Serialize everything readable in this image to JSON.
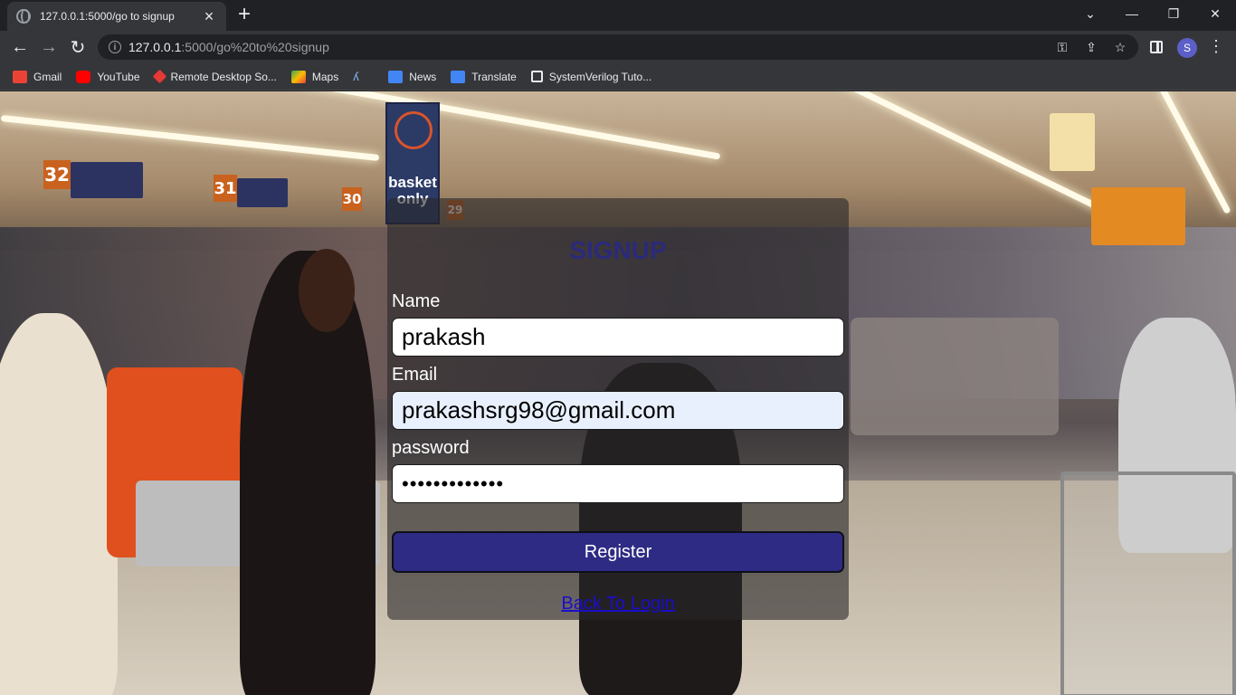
{
  "browser": {
    "tab_title": "127.0.0.1:5000/go to signup",
    "new_tab_symbol": "+",
    "url_host": "127.0.0.1",
    "url_rest": ":5000/go%20to%20signup",
    "profile_initial": "S",
    "window_controls": [
      "⌄",
      "—",
      "❐",
      "✕"
    ]
  },
  "bookmarks": [
    {
      "label": "Gmail",
      "icon": "gmail-icon",
      "color": "#ea4335"
    },
    {
      "label": "YouTube",
      "icon": "youtube-icon",
      "color": "#ff0000"
    },
    {
      "label": "Remote Desktop So...",
      "icon": "remote-desktop-icon",
      "color": "#e53935"
    },
    {
      "label": "Maps",
      "icon": "maps-icon",
      "color": "#34a853"
    },
    {
      "label": "",
      "icon": "bookmark-a-icon",
      "color": "#8ab4f8"
    },
    {
      "label": "News",
      "icon": "news-icon",
      "color": "#4285f4"
    },
    {
      "label": "Translate",
      "icon": "translate-icon",
      "color": "#4285f4"
    },
    {
      "label": "SystemVerilog Tuto...",
      "icon": "chip-icon",
      "color": "#e8eaed"
    }
  ],
  "scene_signs": {
    "aisle_32": "32",
    "aisle_31": "31",
    "aisle_30": "30",
    "aisle_29": "29",
    "basket_line1": "basket",
    "basket_line2": "only"
  },
  "signup": {
    "title": "SIGNUP",
    "name_label": "Name",
    "name_value": "prakash",
    "email_label": "Email",
    "email_value": "prakashsrg98@gmail.com",
    "password_label": "password",
    "password_value": "•••••••••••••",
    "register_label": "Register",
    "back_link_label": "Back To Login"
  }
}
